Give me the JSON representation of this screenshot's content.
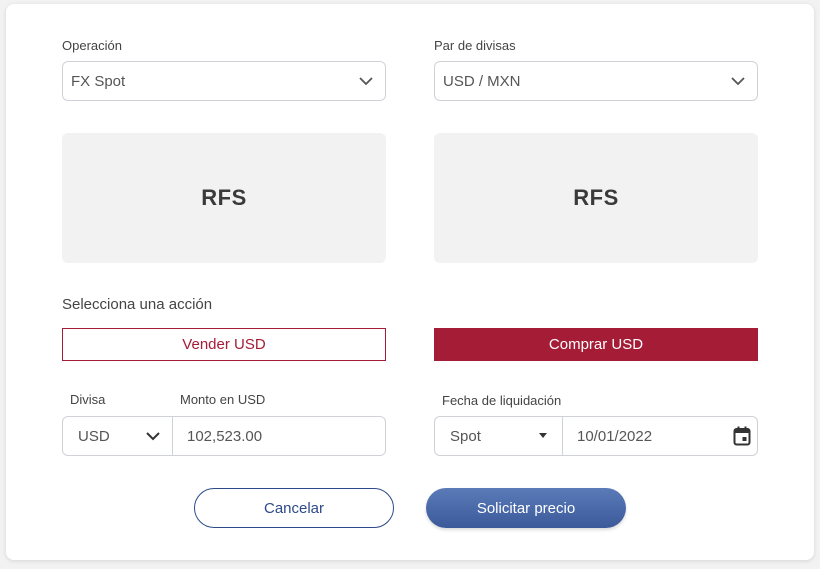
{
  "operation": {
    "label": "Operación",
    "value": "FX Spot"
  },
  "pair": {
    "label": "Par de divisas",
    "value": "USD / MXN"
  },
  "rfs_panels": [
    "RFS",
    "RFS"
  ],
  "action": {
    "label": "Selecciona una acción",
    "sell_label": "Vender USD",
    "buy_label": "Comprar USD"
  },
  "currency": {
    "label": "Divisa",
    "value": "USD"
  },
  "amount": {
    "label": "Monto en USD",
    "value": "102,523.00"
  },
  "settlement": {
    "label": "Fecha de liquidación",
    "type_value": "Spot",
    "date_value": "10/01/2022"
  },
  "buttons": {
    "cancel": "Cancelar",
    "request_price": "Solicitar precio"
  },
  "colors": {
    "accent": "#a51c36",
    "primary": "#3c5a9a"
  },
  "icons": {
    "dropdown": "chevron-down-icon",
    "caret": "caret-down-icon",
    "calendar": "calendar-icon"
  }
}
